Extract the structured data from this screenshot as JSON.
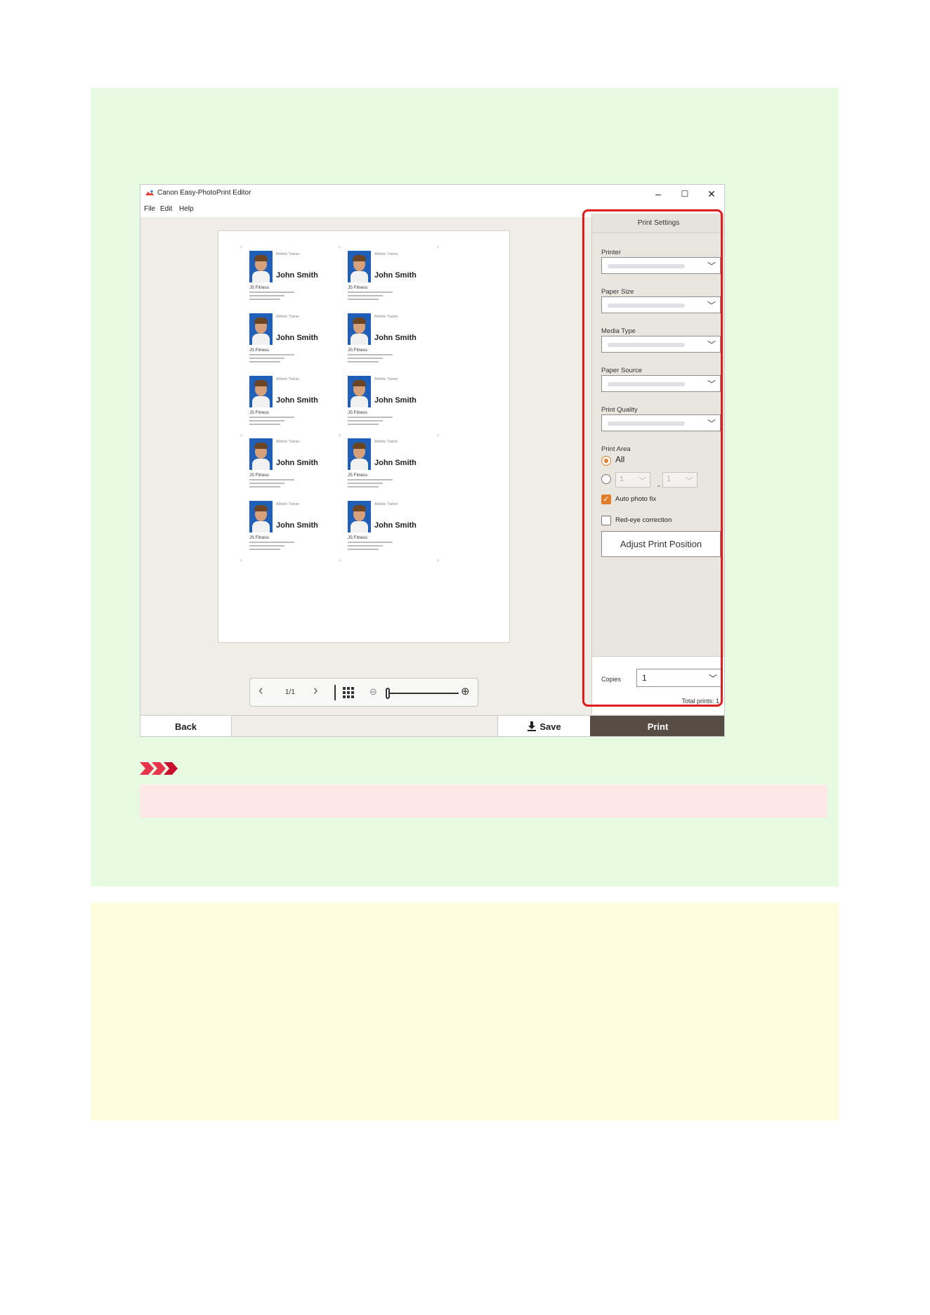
{
  "window": {
    "title": "Canon Easy-PhotoPrint Editor",
    "controls": {
      "minimize": "–",
      "maximize": "☐",
      "close": "✕"
    }
  },
  "menu": {
    "file": "File",
    "edit": "Edit",
    "help": "Help"
  },
  "card": {
    "role": "Athletic Trainer",
    "name": "John Smith",
    "company": "JS Fitness"
  },
  "navigator": {
    "page": "1/1",
    "prev_icon": "chevron-left-icon",
    "next_icon": "chevron-right-icon",
    "layout_icon": "grid-icon",
    "zoom_out_icon": "zoom-out-icon",
    "zoom_in_icon": "zoom-in-icon"
  },
  "print_settings": {
    "title": "Print Settings",
    "printer_label": "Printer",
    "paper_size_label": "Paper Size",
    "media_type_label": "Media Type",
    "paper_source_label": "Paper Source",
    "print_quality_label": "Print Quality",
    "print_area_label": "Print Area",
    "print_area_all": "All",
    "range_from": "1",
    "range_to": "1",
    "range_dash": "-",
    "auto_photo_fix_label": "Auto photo fix",
    "auto_photo_fix_checked": true,
    "red_eye_label": "Red-eye correction",
    "red_eye_checked": false,
    "adjust_button": "Adjust Print Position",
    "copies_label": "Copies",
    "copies_value": "1",
    "total_prints": "Total prints: 1"
  },
  "bottom": {
    "back": "Back",
    "save": "Save",
    "print": "Print"
  },
  "colors": {
    "green_panel": "#e7fbe3",
    "yellow_panel": "#fefedf",
    "highlight": "#e01c1c",
    "print_button": "#574c43",
    "accent": "#e07e2c",
    "important_box": "#fde8e8"
  }
}
